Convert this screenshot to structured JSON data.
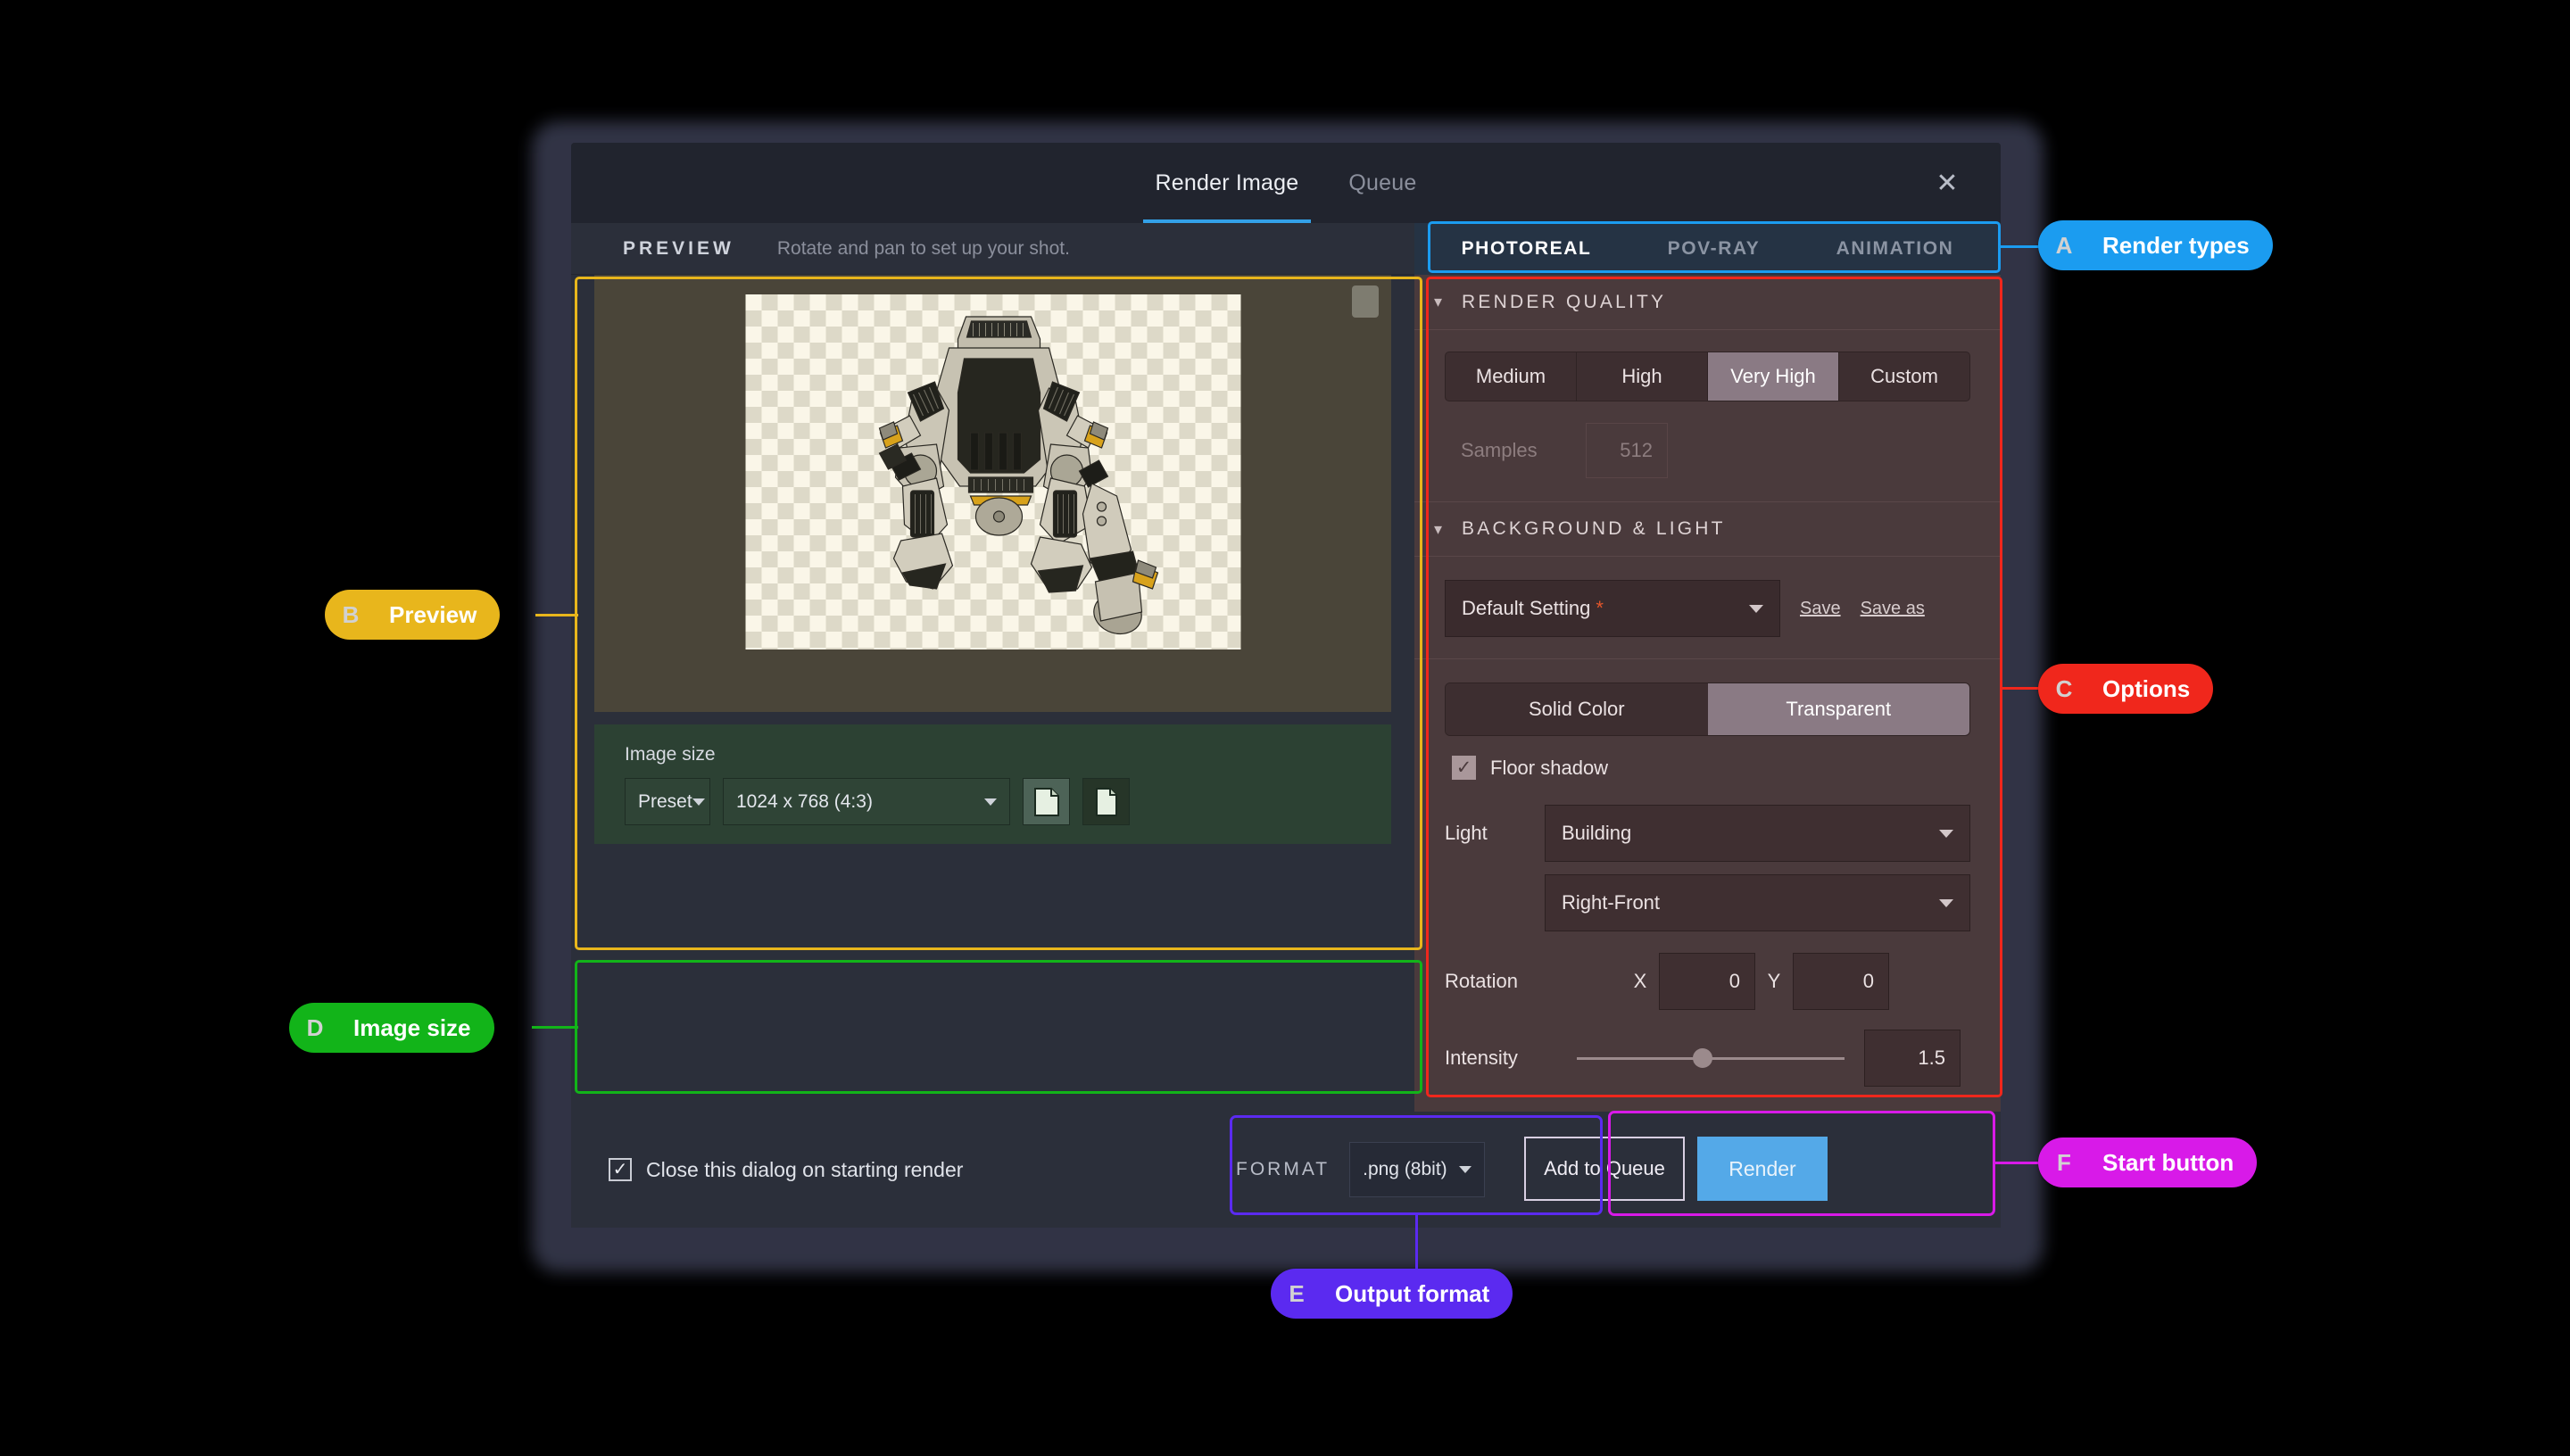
{
  "window": {
    "tabs": [
      {
        "label": "Render Image",
        "active": true
      },
      {
        "label": "Queue",
        "active": false
      }
    ],
    "close_icon": "close-icon"
  },
  "preview": {
    "label": "PREVIEW",
    "hint": "Rotate and pan to set up your shot.",
    "subject": "mech-robot-3d-model",
    "background": "transparent-checkerboard"
  },
  "image_size": {
    "label": "Image size",
    "mode": "Preset",
    "resolution": "1024 x 768 (4:3)",
    "orientation_buttons": [
      {
        "name": "landscape-icon",
        "active": true
      },
      {
        "name": "portrait-icon",
        "active": false
      }
    ]
  },
  "render_types": {
    "tabs": [
      {
        "label": "PHOTOREAL",
        "active": true
      },
      {
        "label": "POV-RAY",
        "active": false
      },
      {
        "label": "ANIMATION",
        "active": false
      }
    ]
  },
  "render_quality": {
    "title": "RENDER QUALITY",
    "options": [
      {
        "label": "Medium",
        "selected": false
      },
      {
        "label": "High",
        "selected": false
      },
      {
        "label": "Very High",
        "selected": true
      },
      {
        "label": "Custom",
        "selected": false
      }
    ],
    "samples_label": "Samples",
    "samples_value": "512"
  },
  "background_light": {
    "title": "BACKGROUND & LIGHT",
    "preset_value": "Default Setting",
    "preset_modified_marker": "*",
    "save_label": "Save",
    "save_as_label": "Save as",
    "bg_modes": [
      {
        "label": "Solid Color",
        "selected": false
      },
      {
        "label": "Transparent",
        "selected": true
      }
    ],
    "floor_shadow_label": "Floor shadow",
    "floor_shadow_checked": true,
    "light_label": "Light",
    "light_type": "Building",
    "light_direction": "Right-Front",
    "rotation_label": "Rotation",
    "rotation_x_label": "X",
    "rotation_x_value": "0",
    "rotation_y_label": "Y",
    "rotation_y_value": "0",
    "intensity_label": "Intensity",
    "intensity_value": "1.5",
    "intensity_percent": 47
  },
  "footer": {
    "close_dialog_label": "Close this dialog on starting render",
    "close_dialog_checked": true,
    "format_label": "FORMAT",
    "format_value": ".png (8bit)",
    "add_to_queue_label": "Add to Queue",
    "render_label": "Render"
  },
  "annotations": [
    {
      "key": "A",
      "label": "Render types",
      "color": "#1b9cf0"
    },
    {
      "key": "B",
      "label": "Preview",
      "color": "#e8b61c"
    },
    {
      "key": "C",
      "label": "Options",
      "color": "#f0271c"
    },
    {
      "key": "D",
      "label": "Image size",
      "color": "#12b419"
    },
    {
      "key": "E",
      "label": "Output format",
      "color": "#5b2af0"
    },
    {
      "key": "F",
      "label": "Start button",
      "color": "#d81ae8"
    }
  ]
}
